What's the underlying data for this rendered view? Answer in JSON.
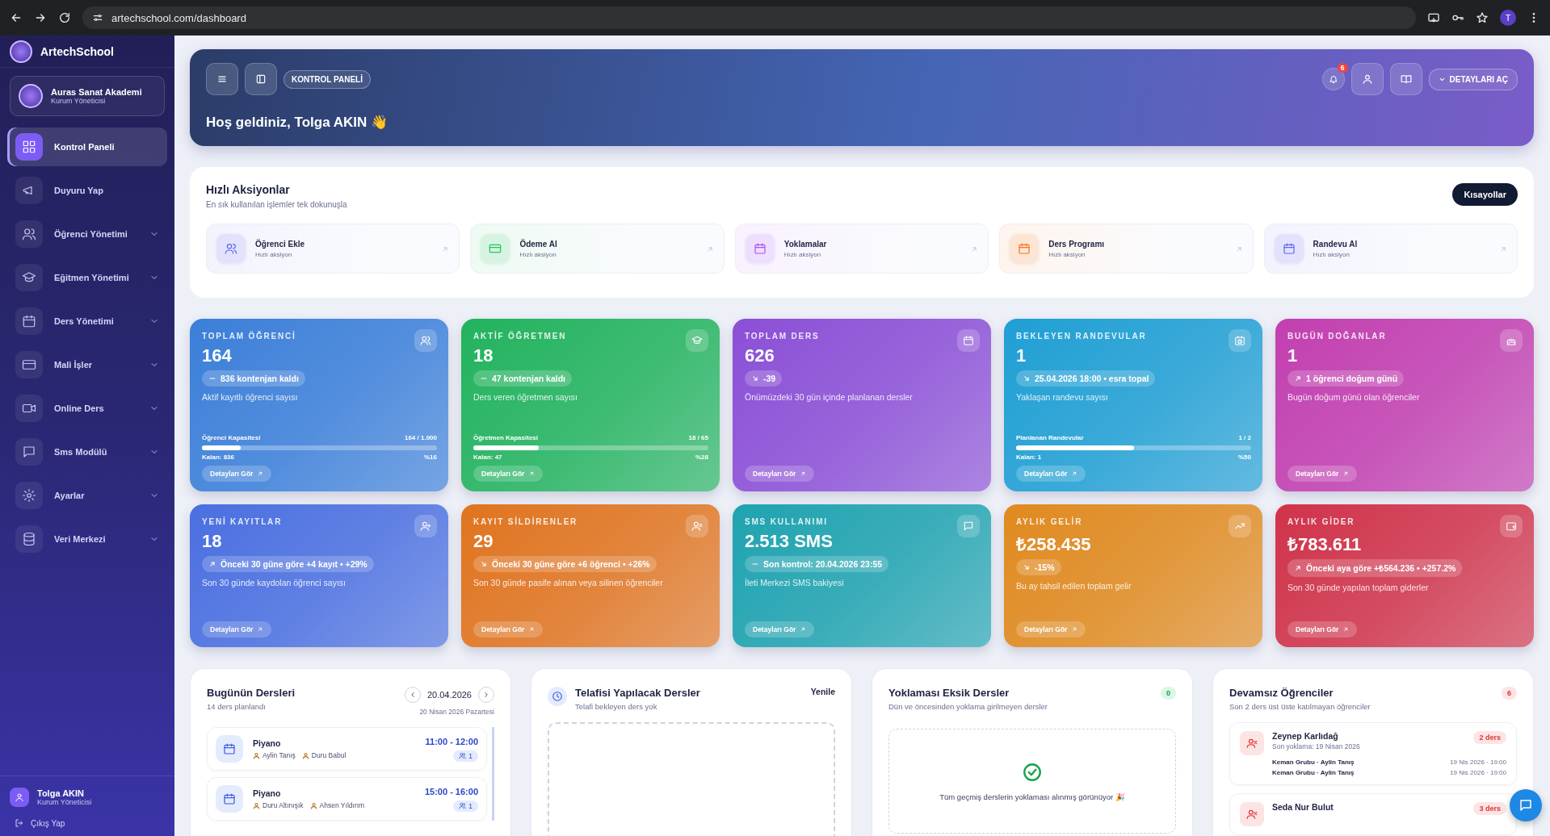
{
  "browser": {
    "url": "artechschool.com/dashboard",
    "profile_initial": "T"
  },
  "sidebar": {
    "brand": "ArtechSchool",
    "org": {
      "name": "Auras Sanat Akademi",
      "role": "Kurum Yöneticisi"
    },
    "items": [
      {
        "label": "Kontrol Paneli",
        "selected": true,
        "expandable": false
      },
      {
        "label": "Duyuru Yap",
        "selected": false,
        "expandable": false
      },
      {
        "label": "Öğrenci Yönetimi",
        "selected": false,
        "expandable": true
      },
      {
        "label": "Eğitmen Yönetimi",
        "selected": false,
        "expandable": true
      },
      {
        "label": "Ders Yönetimi",
        "selected": false,
        "expandable": true
      },
      {
        "label": "Mali İşler",
        "selected": false,
        "expandable": true
      },
      {
        "label": "Online Ders",
        "selected": false,
        "expandable": true
      },
      {
        "label": "Sms Modülü",
        "selected": false,
        "expandable": true
      },
      {
        "label": "Ayarlar",
        "selected": false,
        "expandable": true
      },
      {
        "label": "Veri Merkezi",
        "selected": false,
        "expandable": true
      }
    ],
    "user": {
      "name": "Tolga AKIN",
      "role": "Kurum Yöneticisi"
    },
    "logout": "Çıkış Yap"
  },
  "header": {
    "breadcrumb": "KONTROL PANELİ",
    "greeting": "Hoş geldiniz, Tolga AKIN 👋",
    "notification_count": "6",
    "details_button": "DETAYLARI AÇ"
  },
  "quick_actions": {
    "title": "Hızlı Aksiyonlar",
    "subtitle": "En sık kullanılan işlemler tek dokunuşla",
    "shortcuts_button": "Kısayollar",
    "items": [
      {
        "label": "Öğrenci Ekle",
        "caption": "Hızlı aksiyon",
        "color": "#6366f1"
      },
      {
        "label": "Ödeme Al",
        "caption": "Hızlı aksiyon",
        "color": "#22c55e"
      },
      {
        "label": "Yoklamalar",
        "caption": "Hızlı aksiyon",
        "color": "#a855f7"
      },
      {
        "label": "Ders Programı",
        "caption": "Hızlı aksiyon",
        "color": "#f97316"
      },
      {
        "label": "Randevu Al",
        "caption": "Hızlı aksiyon",
        "color": "#6366f1"
      }
    ]
  },
  "stats": [
    {
      "title": "TOPLAM ÖĞRENCİ",
      "value": "164",
      "kind": "flat",
      "badge": "836 kontenjan kaldı",
      "description": "Aktif kayıtlı öğrenci sayısı",
      "color": "#3b7fd9",
      "progress": {
        "label": "Öğrenci Kapasitesi",
        "reading": "164 / 1.000",
        "level": 0.164,
        "remaining": "Kalan: 836",
        "percent": "%16"
      },
      "link": "Detayları Gör"
    },
    {
      "title": "AKTİF ÖĞRETMEN",
      "value": "18",
      "kind": "flat",
      "badge": "47 kontenjan kaldı",
      "description": "Ders veren öğretmen sayısı",
      "color": "#22b35e",
      "progress": {
        "label": "Öğretmen Kapasitesi",
        "reading": "18 / 65",
        "level": 0.28,
        "remaining": "Kalan: 47",
        "percent": "%28"
      },
      "link": "Detayları Gör"
    },
    {
      "title": "TOPLAM DERS",
      "value": "626",
      "kind": "down",
      "badge": "-39",
      "description": "Önümüzdeki 30 gün içinde planlanan dersler",
      "color": "#8b4fd6",
      "link": "Detayları Gör"
    },
    {
      "title": "BEKLEYEN RANDEVULAR",
      "value": "1",
      "kind": "down",
      "badge": "25.04.2026 18:00 • esra topal",
      "description": "Yaklaşan randevu sayısı",
      "color": "#1f9fd4",
      "progress": {
        "label": "Planlanan Randevular",
        "reading": "1 / 2",
        "level": 0.5,
        "remaining": "Kalan: 1",
        "percent": "%50"
      },
      "link": "Detayları Gör"
    },
    {
      "title": "BUGÜN DOĞANLAR",
      "value": "1",
      "kind": "up",
      "badge": "1 öğrenci doğum günü",
      "description": "Bugün doğum günü olan öğrenciler",
      "color": "#c23fb0",
      "link": "Detayları Gör"
    },
    {
      "title": "YENİ KAYITLAR",
      "value": "18",
      "kind": "up",
      "badge": "Önceki 30 güne göre +4 kayıt • +29%",
      "description": "Son 30 günde kaydolan öğrenci sayısı",
      "color": "#4a6fe0",
      "link": "Detayları Gör"
    },
    {
      "title": "KAYIT SİLDİRENLER",
      "value": "29",
      "kind": "down",
      "badge": "Önceki 30 güne göre +6 öğrenci • +26%",
      "description": "Son 30 günde pasife alınan veya silinen öğrenciler",
      "color": "#e0741f",
      "link": "Detayları Gör"
    },
    {
      "title": "SMS KULLANIMI",
      "value": "2.513 SMS",
      "kind": "flat",
      "badge": "Son kontrol: 20.04.2026 23:55",
      "description": "İleti Merkezi SMS bakiyesi",
      "color": "#1fa3b0",
      "link": "Detayları Gör"
    },
    {
      "title": "AYLIK GELİR",
      "value": "₺258.435",
      "kind": "down",
      "badge": "-15%",
      "description": "Bu ay tahsil edilen toplam gelir",
      "color": "#e08a1f",
      "link": "Detayları Gör"
    },
    {
      "title": "AYLIK GİDER",
      "value": "₺783.611",
      "kind": "up",
      "badge": "Önceki aya göre +₺564.236 • +257.2%",
      "description": "Son 30 günde yapılan toplam giderler",
      "color": "#d0334a",
      "link": "Detayları Gör"
    }
  ],
  "today_lessons": {
    "title": "Bugünün Dersleri",
    "subtitle": "14 ders planlandı",
    "date": "20.04.2026",
    "date_long": "20 Nisan 2026 Pazartesi",
    "lessons": [
      {
        "name": "Piyano",
        "teachers": [
          "Aylin Tanış",
          "Duru Babul"
        ],
        "time": "11:00 - 12:00",
        "count": "1"
      },
      {
        "name": "Piyano",
        "teachers": [
          "Duru Altınışık",
          "Ahsen Yıldırım"
        ],
        "time": "15:00 - 16:00",
        "count": "1"
      }
    ]
  },
  "makeup_lessons": {
    "title": "Telafisi Yapılacak Dersler",
    "subtitle": "Telafi bekleyen ders yok",
    "action": "Yenile"
  },
  "missing_attendance": {
    "title": "Yoklaması Eksik Dersler",
    "subtitle": "Dün ve öncesinden yoklama girilmeyen dersler",
    "count": "0",
    "empty_message": "Tüm geçmiş derslerin yoklaması alınmış görünüyor 🎉"
  },
  "absent_students": {
    "title": "Devamsız Öğrenciler",
    "subtitle": "Son 2 ders üst üste katılmayan öğrenciler",
    "count": "6",
    "students": [
      {
        "name": "Zeynep Karlıdağ",
        "last_attendance": "Son yoklama: 19 Nisan 2026",
        "badge": "2 ders",
        "records": [
          {
            "group": "Keman Grubu · Aylin Tanış",
            "time": "19 Nis 2026 · 19:00"
          },
          {
            "group": "Keman Grubu · Aylin Tanış",
            "time": "19 Nis 2026 · 19:00"
          }
        ]
      },
      {
        "name": "Seda Nur Bulut",
        "badge": "3 ders"
      }
    ]
  }
}
